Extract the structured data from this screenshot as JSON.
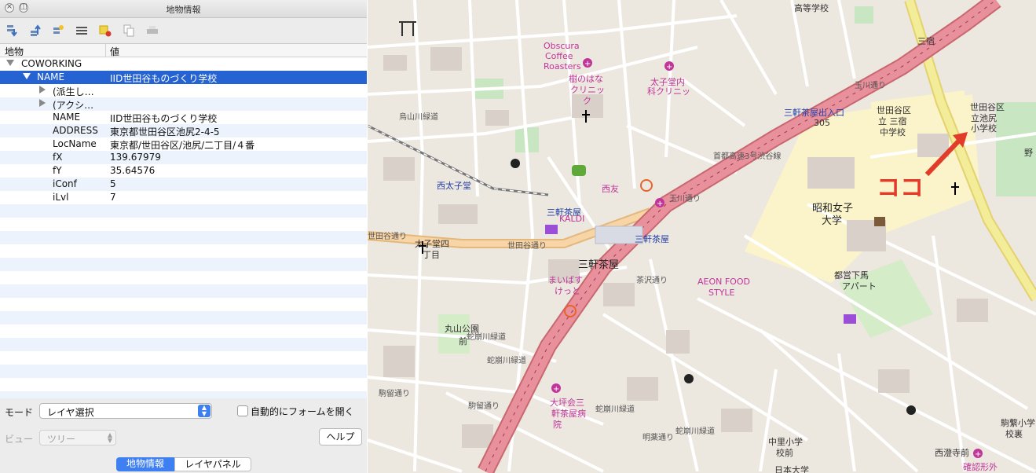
{
  "window": {
    "title": "地物情報"
  },
  "toolbar": {
    "icons": [
      "expand-icon",
      "collapse-icon",
      "expand-new-icon",
      "form-view-icon",
      "clear-highlight-icon",
      "copy-icon",
      "print-icon"
    ]
  },
  "table": {
    "col_feature": "地物",
    "col_value": "値",
    "rows": [
      {
        "indent": 0,
        "expander": "down",
        "key": "COWORKING",
        "value": ""
      },
      {
        "indent": 1,
        "expander": "down",
        "key": "NAME",
        "value": "IID世田谷ものづくり学校",
        "selected": true
      },
      {
        "indent": 2,
        "expander": "right",
        "key": "(派生し…",
        "value": ""
      },
      {
        "indent": 2,
        "expander": "right",
        "key": "(アクシ…",
        "value": ""
      },
      {
        "indent": 2,
        "expander": "",
        "key": "NAME",
        "value": "IID世田谷ものづくり学校"
      },
      {
        "indent": 2,
        "expander": "",
        "key": "ADDRESS",
        "value": "東京都世田谷区池尻2-4-5"
      },
      {
        "indent": 2,
        "expander": "",
        "key": "LocName",
        "value": "東京都/世田谷区/池尻/二丁目/４番"
      },
      {
        "indent": 2,
        "expander": "",
        "key": "fX",
        "value": "139.67979"
      },
      {
        "indent": 2,
        "expander": "",
        "key": "fY",
        "value": "35.64576"
      },
      {
        "indent": 2,
        "expander": "",
        "key": "iConf",
        "value": "5"
      },
      {
        "indent": 2,
        "expander": "",
        "key": "iLvl",
        "value": "7"
      }
    ]
  },
  "bottom": {
    "mode_label": "モード",
    "mode_value": "レイヤ選択",
    "view_label": "ビュー",
    "view_value": "ツリー",
    "auto_form_label": "自動的にフォームを開く",
    "auto_form_checked": false,
    "help_label": "ヘルプ",
    "tabs": [
      "地物情報",
      "レイヤパネル"
    ],
    "active_tab": "地物情報"
  },
  "map": {
    "annotation": "ココ",
    "labels": [
      "高等学校",
      "Obscura",
      "Coffee",
      "Roasters",
      "樹のはな",
      "クリニッ",
      "ク",
      "太子堂内",
      "科クリニッ",
      "三宿",
      "玉川通り",
      "三軒茶屋出入口",
      "305",
      "世田谷区",
      "立 三宿",
      "中学校",
      "世田谷区",
      "立池尻",
      "小学校",
      "烏山川緑道",
      "首都高速3号渋谷線",
      "西太子堂",
      "西友",
      "玉川通り",
      "三軒茶屋",
      "KALDI",
      "昭和女子",
      "大学",
      "世田谷通り",
      "太子堂四",
      "丁目",
      "世田谷通り",
      "三軒茶屋",
      "三軒茶屋",
      "茶沢通り",
      "まいばす",
      "けっと",
      "AEON FOOD",
      "STYLE",
      "都営下馬",
      "アパート",
      "蛇崩川緑道",
      "丸山公園",
      "前",
      "蛇崩川緑道",
      "駒留通り",
      "駒留通り",
      "大坪会三",
      "軒茶屋病",
      "院",
      "蛇崩川緑道",
      "蛇崩川緑道",
      "明薬通り",
      "中里小学",
      "校前",
      "日本大学",
      "西澄寺前",
      "駒繋小学",
      "校裏",
      "確認形外",
      "野"
    ]
  },
  "colors": {
    "selection": "#2463d1",
    "stripe": "#ecf3fc",
    "accent": "#3e7ff2",
    "motorway": "#e8909c",
    "trunk": "#f7d38f",
    "annotation": "#e33b2a"
  }
}
